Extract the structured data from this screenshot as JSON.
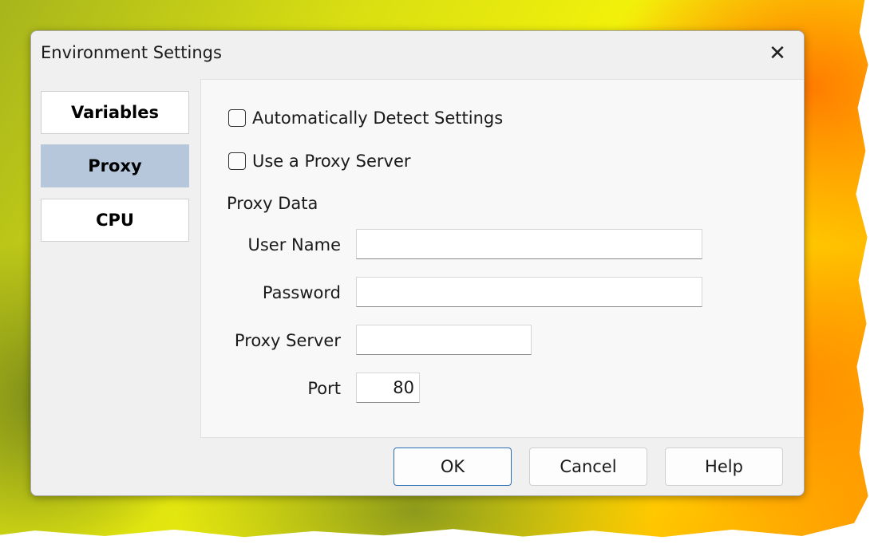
{
  "window": {
    "title": "Environment Settings",
    "close_icon": "close-icon"
  },
  "tabs": [
    {
      "label": "Variables",
      "active": false
    },
    {
      "label": "Proxy",
      "active": true
    },
    {
      "label": "CPU",
      "active": false
    }
  ],
  "proxy": {
    "auto_detect_label": "Automatically Detect Settings",
    "auto_detect_checked": false,
    "use_proxy_label": "Use a Proxy Server",
    "use_proxy_checked": false,
    "section_label": "Proxy Data",
    "user_name_label": "User Name",
    "user_name_value": "",
    "password_label": "Password",
    "password_value": "",
    "proxy_server_label": "Proxy Server",
    "proxy_server_value": "",
    "port_label": "Port",
    "port_value": "80"
  },
  "buttons": {
    "ok": "OK",
    "cancel": "Cancel",
    "help": "Help"
  },
  "colors": {
    "active_tab": "#b7c7db",
    "default_button_border": "#2a6db3"
  }
}
